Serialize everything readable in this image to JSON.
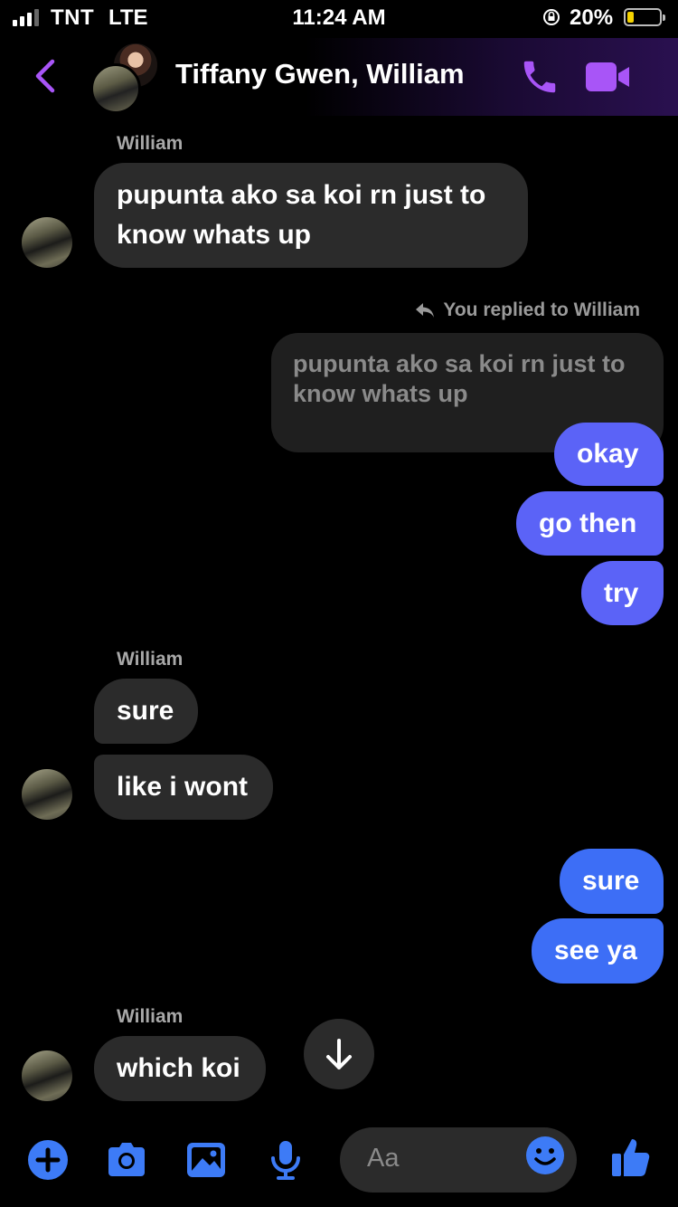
{
  "status_bar": {
    "carrier": "TNT",
    "network": "LTE",
    "time": "11:24 AM",
    "battery_percent": "20%",
    "battery_level": 0.2
  },
  "header": {
    "title": "Tiffany Gwen, William",
    "accent_color": "#a855f7"
  },
  "messages": [
    {
      "sender": "William",
      "text": "pupunta ako sa koi rn just to know whats up"
    },
    {
      "reply_note": "You replied to William",
      "quoted": "pupunta ako sa koi rn just to know whats up"
    },
    {
      "text": "okay"
    },
    {
      "text": "go then"
    },
    {
      "text": "try"
    },
    {
      "sender": "William",
      "text": "sure"
    },
    {
      "text": "like i wont"
    },
    {
      "text": "sure"
    },
    {
      "text": "see ya"
    },
    {
      "sender": "William",
      "text": "which koi"
    }
  ],
  "composer": {
    "placeholder": "Aa",
    "icons": [
      "plus-icon",
      "camera-icon",
      "image-icon",
      "mic-icon",
      "emoji-icon",
      "thumbs-up-icon"
    ],
    "icon_color": "#3d7bf6"
  },
  "colors": {
    "outgoing_purple": "#5b63f7",
    "outgoing_blue": "#3d6ef6",
    "incoming": "#2b2b2b"
  }
}
